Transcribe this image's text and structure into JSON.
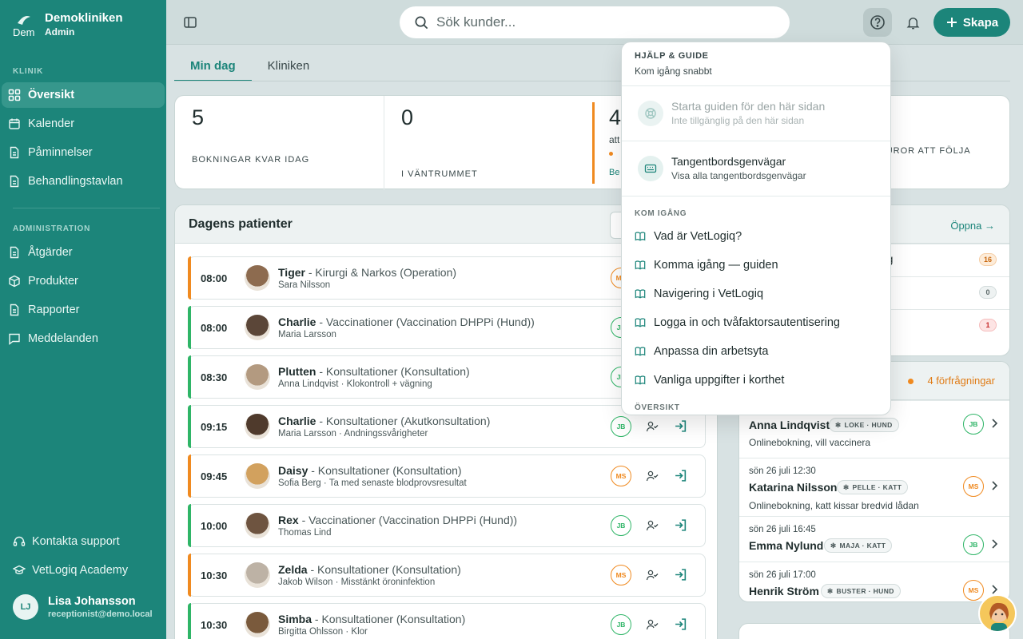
{
  "brand": {
    "name": "Demokliniken",
    "role": "Admin"
  },
  "sidebar": {
    "klinik_title": "KLINIK",
    "klinik_items": [
      {
        "label": "Översikt",
        "icon": "grid-icon",
        "active": true
      },
      {
        "label": "Kalender",
        "icon": "calendar-icon"
      },
      {
        "label": "Påminnelser",
        "icon": "document-icon"
      },
      {
        "label": "Behandlingstavlan",
        "icon": "document-icon"
      }
    ],
    "admin_title": "ADMINISTRATION",
    "admin_items": [
      {
        "label": "Åtgärder",
        "icon": "document-icon"
      },
      {
        "label": "Produkter",
        "icon": "box-icon"
      },
      {
        "label": "Rapporter",
        "icon": "document-icon"
      },
      {
        "label": "Meddelanden",
        "icon": "chat-icon"
      }
    ],
    "support": "Kontakta support",
    "academy": "VetLogiq Academy",
    "user": {
      "initials": "LJ",
      "name": "Lisa Johansson",
      "email": "receptionist@demo.local"
    }
  },
  "topbar": {
    "search_placeholder": "Sök kunder...",
    "create_label": "Skapa"
  },
  "tabs": [
    "Min dag",
    "Kliniken"
  ],
  "stats": [
    {
      "value": "5",
      "label": "BOKNINGAR KVAR IDAG"
    },
    {
      "value": "0",
      "label": "I VÄNTRUMMET"
    },
    {
      "value": "4",
      "label": "att",
      "link": "Be"
    },
    {
      "value": "",
      "label": "TUROR ATT FÖLJA"
    }
  ],
  "patients": {
    "title": "Dagens patienter",
    "rows": [
      {
        "time": "08:00",
        "name": "Tiger",
        "proc": " - Kirurgi & Narkos (Operation)",
        "sub": "Sara Nilsson",
        "staff": "MS",
        "color": "#f08a20"
      },
      {
        "time": "08:00",
        "name": "Charlie",
        "proc": " - Vaccinationer (Vaccination DHPPi (Hund))",
        "sub": "Maria Larsson",
        "staff": "JB",
        "color": "#2fb567"
      },
      {
        "time": "08:30",
        "name": "Plutten",
        "proc": " - Konsultationer (Konsultation)",
        "sub": "Anna Lindqvist · Klokontroll + vägning",
        "staff": "JB",
        "color": "#2fb567"
      },
      {
        "time": "09:15",
        "name": "Charlie",
        "proc": " - Konsultationer (Akutkonsultation)",
        "sub": "Maria Larsson · Andningssvårigheter",
        "staff": "JB",
        "color": "#2fb567"
      },
      {
        "time": "09:45",
        "name": "Daisy",
        "proc": " - Konsultationer (Konsultation)",
        "sub": "Sofia Berg · Ta med senaste blodprovsresultat",
        "staff": "MS",
        "color": "#f08a20"
      },
      {
        "time": "10:00",
        "name": "Rex",
        "proc": " - Vaccinationer (Vaccination DHPPi (Hund))",
        "sub": "Thomas Lind",
        "staff": "JB",
        "color": "#2fb567"
      },
      {
        "time": "10:30",
        "name": "Zelda",
        "proc": " - Konsultationer (Konsultation)",
        "sub": "Jakob Wilson · Misstänkt öroninfektion",
        "staff": "MS",
        "color": "#f08a20"
      },
      {
        "time": "10:30",
        "name": "Simba",
        "proc": " - Konsultationer (Konsultation)",
        "sub": "Birgitta Ohlsson · Klor",
        "staff": "JB",
        "color": "#2fb567"
      }
    ]
  },
  "right_top": {
    "open_label": "Öppna →",
    "rows": [
      {
        "text": "ning",
        "count": "16",
        "tone": "orange"
      },
      {
        "text": "",
        "count": "0",
        "tone": "gray"
      },
      {
        "text": "d",
        "count": "1",
        "tone": "red"
      }
    ]
  },
  "requests": {
    "count_label": "4 förfrågningar",
    "items": [
      {
        "date": "",
        "name": "Anna Lindqvist",
        "tag": "LOKE · HUND",
        "note": "Onlinebokning, vill vaccinera",
        "staff": "JB",
        "color": "#2fb567"
      },
      {
        "date": "sön 26 juli 12:30",
        "name": "Katarina Nilsson",
        "tag": "PELLE · KATT",
        "note": "Onlinebokning, katt kissar bredvid lådan",
        "staff": "MS",
        "color": "#f08a20"
      },
      {
        "date": "sön 26 juli 16:45",
        "name": "Emma Nylund",
        "tag": "MAJA · KATT",
        "note": "",
        "staff": "JB",
        "color": "#2fb567"
      },
      {
        "date": "sön 26 juli 17:00",
        "name": "Henrik Ström",
        "tag": "BUSTER · HUND",
        "note": "",
        "staff": "MS",
        "color": "#f08a20"
      }
    ]
  },
  "help": {
    "title": "HJÄLP & GUIDE",
    "subtitle": "Kom igång snabbt",
    "actions": [
      {
        "title": "Starta guiden för den här sidan",
        "sub": "Inte tillgänglig på den här sidan",
        "disabled": true,
        "icon": "lifebuoy-icon"
      },
      {
        "title": "Tangentbordsgenvägar",
        "sub": "Visa alla tangentbordsgenvägar",
        "disabled": false,
        "icon": "keyboard-icon"
      }
    ],
    "section1": "KOM IGÅNG",
    "links": [
      "Vad är VetLogiq?",
      "Komma igång — guiden",
      "Navigering i VetLogiq",
      "Logga in och tvåfaktorsautentisering",
      "Anpassa din arbetsyta",
      "Vanliga uppgifter i korthet"
    ],
    "section2": "ÖVERSIKT"
  }
}
